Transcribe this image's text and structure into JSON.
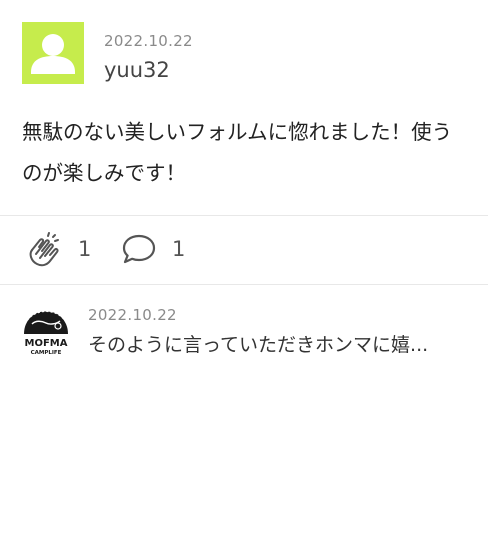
{
  "post": {
    "date": "2022.10.22",
    "username": "yuu32",
    "body": "無駄のない美しいフォルムに惚れました！使うのが楽しみです！"
  },
  "actions": {
    "clap_count": "1",
    "comment_count": "1"
  },
  "reply": {
    "date": "2022.10.22",
    "text": "そのように言っていただきホンマに嬉...",
    "logo_line1": "MOFMA",
    "logo_line2": "CAMPLIFE"
  },
  "colors": {
    "avatar_bg": "#c6ec4c",
    "text_muted": "#8a8a8a",
    "divider": "#e8e8e8"
  },
  "icons": {
    "default_avatar": "user-silhouette-icon",
    "clap": "clap-hands-icon",
    "comment": "speech-bubble-icon"
  }
}
